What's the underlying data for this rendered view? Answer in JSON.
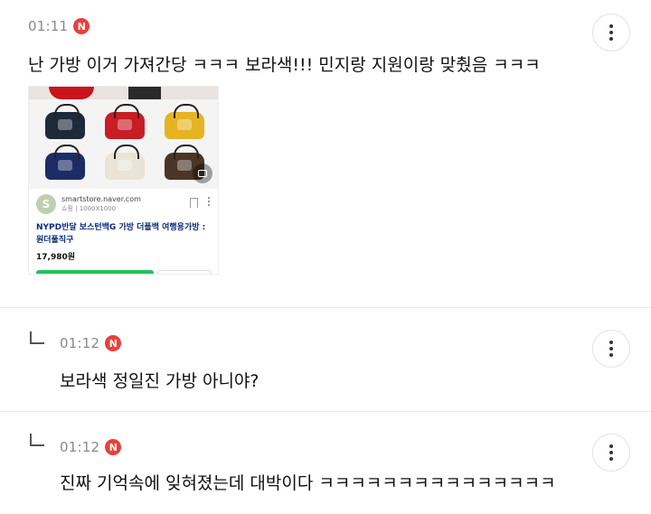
{
  "comments": [
    {
      "time": "01:11",
      "badge": "N",
      "text": "난 가방 이거 가져간당 ㅋㅋㅋ 보라색!!! 민지랑 지원이랑 맞췄음 ㅋㅋㅋ",
      "attachment": {
        "site_logo": "S",
        "domain": "smartstore.naver.com",
        "sub": "쇼핑 | 1000X1000",
        "title": "NYPD반달 보스턴백G 가방 더플백 여행용가방 : 원더풀직구",
        "price": "17,980원",
        "bag_colors": [
          "#1e2a3a",
          "#c81d25",
          "#e6b422",
          "#1d2c66",
          "#e9e4d6",
          "#4a3526"
        ]
      }
    },
    {
      "time": "01:12",
      "badge": "N",
      "text": "보라색 정일진 가방 아니야?"
    },
    {
      "time": "01:12",
      "badge": "N",
      "text": "진짜 기억속에 잊혀졌는데 대박이다 ㅋㅋㅋㅋㅋㅋㅋㅋㅋㅋㅋㅋㅋㅋㅋ"
    }
  ]
}
